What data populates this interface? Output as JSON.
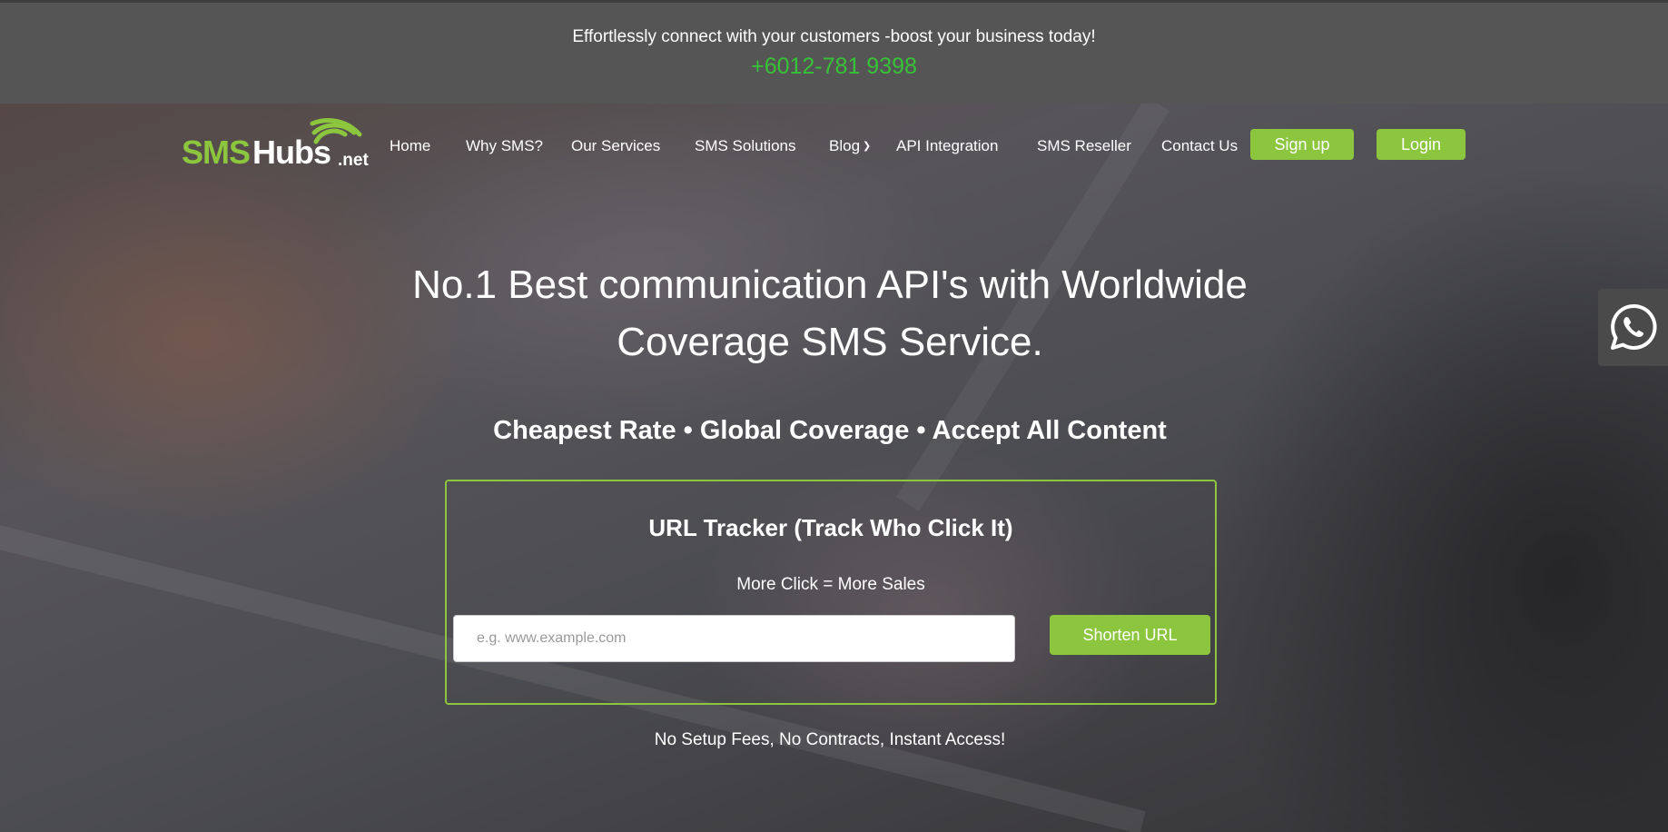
{
  "topbar": {
    "tagline": "Effortlessly connect with your customers -boost your business today!",
    "phone": "+6012-781 9398"
  },
  "logo": {
    "sms": "SMS",
    "hubs": "Hubs",
    "tld": ".net"
  },
  "nav": {
    "items": [
      {
        "label": "Home"
      },
      {
        "label": "Why SMS?"
      },
      {
        "label": "Our Services"
      },
      {
        "label": "SMS Solutions"
      },
      {
        "label": "Blog",
        "has_dropdown": true
      },
      {
        "label": "API Integration"
      },
      {
        "label": "SMS Reseller"
      },
      {
        "label": "Contact Us"
      }
    ],
    "signup_label": "Sign up",
    "login_label": "Login"
  },
  "hero": {
    "headline_line1": "No.1 Best communication API's with Worldwide",
    "headline_line2": "Coverage SMS Service.",
    "subhead": "Cheapest Rate • Global Coverage • Accept All Content",
    "footnote": "No Setup Fees, No Contracts, Instant Access!"
  },
  "tracker": {
    "title": "URL Tracker (Track Who Click It)",
    "subtitle": "More Click = More Sales",
    "input_placeholder": "e.g. www.example.com",
    "input_value": "",
    "button_label": "Shorten URL"
  },
  "icons": {
    "whatsapp": "whatsapp-icon",
    "blog_dropdown": "chevron-down-icon"
  },
  "colors": {
    "brand_green": "#8cc63f",
    "phone_green": "#37c237",
    "topbar_bg": "#555555"
  }
}
